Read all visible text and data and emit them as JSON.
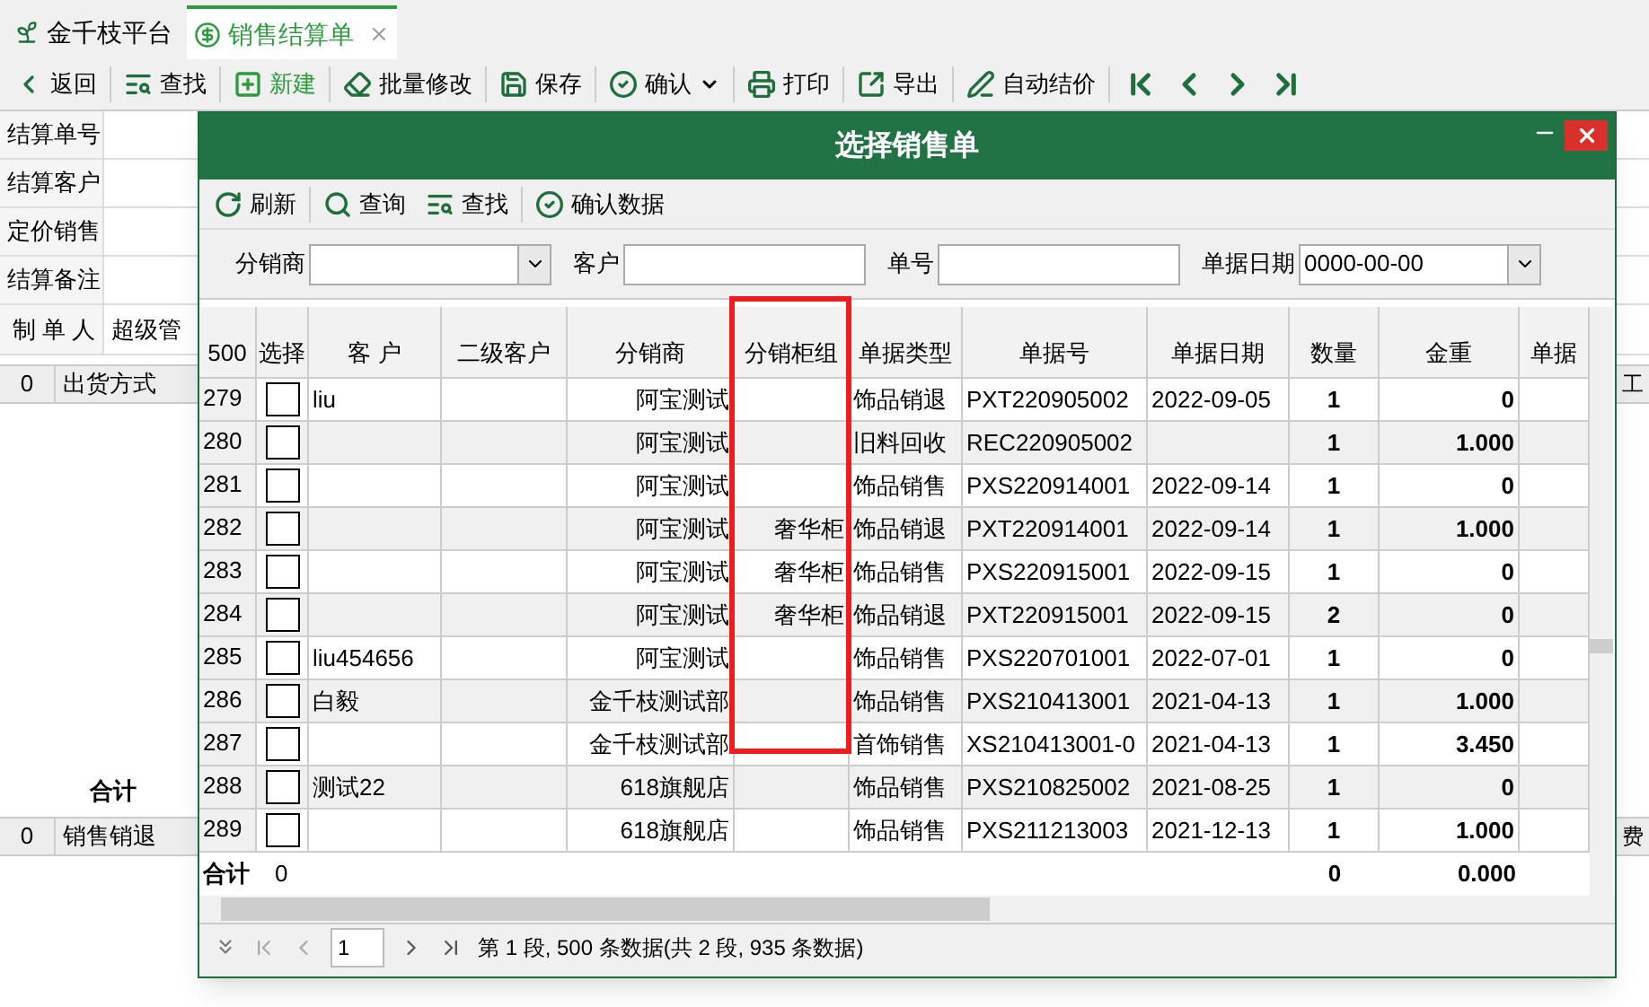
{
  "tabs": [
    {
      "label": "金千枝平台",
      "selected": false,
      "kind": "home"
    },
    {
      "label": "销售结算单",
      "selected": true,
      "kind": "doc"
    }
  ],
  "toolbar": [
    {
      "label": "返回",
      "kind": "back"
    },
    {
      "label": "查找",
      "kind": "find"
    },
    {
      "label": "新建",
      "kind": "new"
    },
    {
      "label": "批量修改",
      "kind": "edit"
    },
    {
      "label": "保存",
      "kind": "save"
    },
    {
      "label": "确认",
      "kind": "confirm",
      "dropdown": true
    },
    {
      "label": "打印",
      "kind": "print"
    },
    {
      "label": "导出",
      "kind": "export"
    },
    {
      "label": "自动结价",
      "kind": "price"
    }
  ],
  "form": {
    "fields": [
      {
        "label": "结算单号"
      },
      {
        "label": "结算客户"
      },
      {
        "label": "定价销售"
      },
      {
        "label": "结算备注"
      }
    ],
    "maker": {
      "label": "制 单 人",
      "value": "超级管"
    },
    "grid1": {
      "count": "0",
      "column_1": "出货方式",
      "column_right": "工"
    },
    "total_label": "合计",
    "grid2": {
      "count": "0",
      "column_1": "销售销退",
      "column_right": "费"
    }
  },
  "dialog": {
    "title": "选择销售单",
    "toolbar": [
      {
        "label": "刷新",
        "kind": "refresh"
      },
      {
        "label": "查询",
        "kind": "query"
      },
      {
        "label": "查找",
        "kind": "find"
      },
      {
        "label": "确认数据",
        "kind": "confirm"
      }
    ],
    "filters": [
      {
        "label": "分销商",
        "kind": "combo"
      },
      {
        "label": "客户",
        "kind": "text"
      },
      {
        "label": "单号",
        "kind": "text"
      },
      {
        "label": "单据日期",
        "kind": "combo",
        "value": "0000-00-00"
      }
    ],
    "table": {
      "count": "500",
      "columns": [
        {
          "label": "选择",
          "highlighted": false
        },
        {
          "label": "客 户",
          "highlighted": false
        },
        {
          "label": "二级客户",
          "highlighted": false
        },
        {
          "label": "分销商",
          "highlighted": false
        },
        {
          "label": "分销柜组",
          "highlighted": true
        },
        {
          "label": "单据类型",
          "highlighted": false
        },
        {
          "label": "单据号",
          "highlighted": false
        },
        {
          "label": "单据日期",
          "highlighted": false
        },
        {
          "label": "数量",
          "highlighted": false
        },
        {
          "label": "金重",
          "highlighted": false
        },
        {
          "label": "单据",
          "highlighted": false
        }
      ],
      "rows": [
        {
          "no": "279",
          "checked": false,
          "customer": "liu",
          "distributor": "阿宝测试",
          "type": "饰品销退",
          "doc_no": "PXT220905002",
          "date": "2022-09-05",
          "qty": "1",
          "weight": "0"
        },
        {
          "no": "280",
          "checked": false,
          "distributor": "阿宝测试",
          "type": "旧料回收",
          "doc_no": "REC220905002",
          "qty": "1",
          "weight": "1.000"
        },
        {
          "no": "281",
          "checked": false,
          "distributor": "阿宝测试",
          "type": "饰品销售",
          "doc_no": "PXS220914001",
          "date": "2022-09-14",
          "qty": "1",
          "weight": "0"
        },
        {
          "no": "282",
          "checked": false,
          "distributor": "阿宝测试",
          "group": "奢华柜",
          "type": "饰品销退",
          "doc_no": "PXT220914001",
          "date": "2022-09-14",
          "qty": "1",
          "weight": "1.000"
        },
        {
          "no": "283",
          "checked": false,
          "distributor": "阿宝测试",
          "group": "奢华柜",
          "type": "饰品销售",
          "doc_no": "PXS220915001",
          "date": "2022-09-15",
          "qty": "1",
          "weight": "0"
        },
        {
          "no": "284",
          "checked": false,
          "distributor": "阿宝测试",
          "group": "奢华柜",
          "type": "饰品销退",
          "doc_no": "PXT220915001",
          "date": "2022-09-15",
          "qty": "2",
          "weight": "0"
        },
        {
          "no": "285",
          "checked": false,
          "customer": "liu454656",
          "distributor": "阿宝测试",
          "type": "饰品销售",
          "doc_no": "PXS220701001",
          "date": "2022-07-01",
          "qty": "1",
          "weight": "0"
        },
        {
          "no": "286",
          "checked": false,
          "customer": "白毅",
          "distributor": "金千枝测试部",
          "type": "饰品销售",
          "doc_no": "PXS210413001",
          "date": "2021-04-13",
          "qty": "1",
          "weight": "1.000"
        },
        {
          "no": "287",
          "checked": false,
          "distributor": "金千枝测试部",
          "type": "首饰销售",
          "doc_no": "XS210413001-0",
          "date": "2021-04-13",
          "qty": "1",
          "weight": "3.450"
        },
        {
          "no": "288",
          "checked": false,
          "customer": "测试22",
          "distributor": "618旗舰店",
          "type": "饰品销售",
          "doc_no": "PXS210825002",
          "date": "2021-08-25",
          "qty": "1",
          "weight": "0"
        },
        {
          "no": "289",
          "checked": false,
          "distributor": "618旗舰店",
          "type": "饰品销售",
          "doc_no": "PXS211213003",
          "date": "2021-12-13",
          "qty": "1",
          "weight": "1.000"
        }
      ],
      "totals": {
        "label": "合计",
        "count": "0",
        "qty": "0",
        "weight": "0.000"
      }
    },
    "pager": {
      "page": "1",
      "summary": "第 1 段, 500 条数据(共 2 段, 935 条数据)"
    }
  }
}
